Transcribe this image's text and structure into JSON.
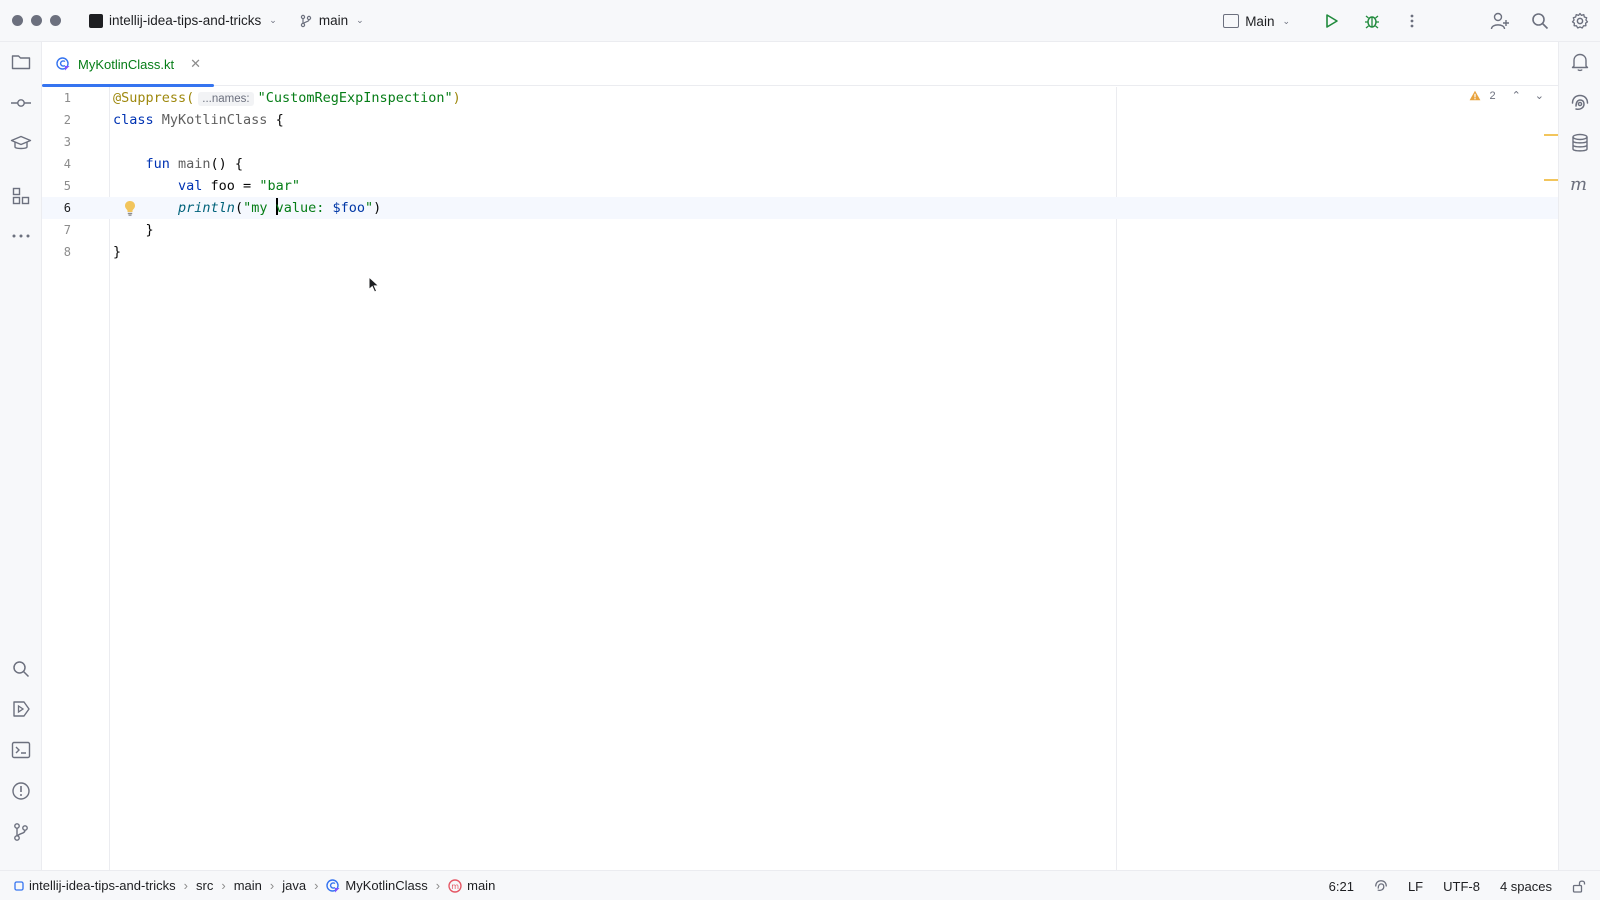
{
  "titlebar": {
    "project_name": "intellij-idea-tips-and-tricks",
    "branch": "main",
    "run_config": "Main"
  },
  "tabs": [
    {
      "label": "MyKotlinClass.kt"
    }
  ],
  "editor": {
    "line_numbers": [
      "1",
      "2",
      "3",
      "4",
      "5",
      "6",
      "7",
      "8"
    ],
    "hint_label": "...names:",
    "inspection_count": "2",
    "code": {
      "l1_annotation": "@Suppress(",
      "l1_string": "\"CustomRegExpInspection\"",
      "l1_close": ")",
      "l2_kw": "class",
      "l2_name": " MyKotlinClass ",
      "l2_brace": "{",
      "l4_indent": "    ",
      "l4_kw": "fun",
      "l4_name": " main",
      "l4_rest": "() {",
      "l5_indent": "        ",
      "l5_kw": "val",
      "l5_rest": " foo = ",
      "l5_string": "\"bar\"",
      "l6_indent": "        ",
      "l6_fn": "println",
      "l6_open": "(",
      "l6_str_a": "\"my ",
      "l6_str_b": "value: ",
      "l6_template": "$foo",
      "l6_str_c": "\"",
      "l6_close": ")",
      "l7": "    }",
      "l8": "}"
    }
  },
  "statusbar": {
    "breadcrumbs": [
      "intellij-idea-tips-and-tricks",
      "src",
      "main",
      "java",
      "MyKotlinClass",
      "main"
    ],
    "position": "6:21",
    "line_separator": "LF",
    "encoding": "UTF-8",
    "indent": "4 spaces"
  },
  "colors": {
    "accent": "#3574f0",
    "keyword": "#0033b3",
    "string": "#067d17",
    "annotation": "#9e880d",
    "warning": "#f2c55c"
  }
}
